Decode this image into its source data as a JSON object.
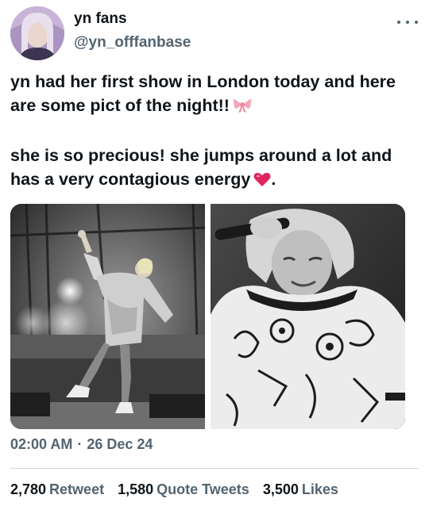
{
  "author": {
    "display_name": "yn fans",
    "handle": "@yn_offfanbase"
  },
  "tweet": {
    "paragraph_1": "yn had her first show in London today and here are some pict of the night!!",
    "paragraph_2": "she is so precious! she jumps around a lot and has a very contagious energy",
    "paragraph_2_end": ".",
    "emoji_1": "ribbon-emoji",
    "emoji_2": "red-heart-emoji"
  },
  "meta": {
    "time": "02:00 AM",
    "separator": "·",
    "date": "26 Dec 24"
  },
  "stats": [
    {
      "count": "2,780",
      "label": "Retweet"
    },
    {
      "count": "1,580",
      "label": "Quote Tweets"
    },
    {
      "count": "3,500",
      "label": "Likes"
    }
  ],
  "colors": {
    "text_primary": "#0f1419",
    "text_secondary": "#536471",
    "divider": "#cfd9de",
    "heart": "#e0245e",
    "ribbon": "#f4a6b8"
  }
}
